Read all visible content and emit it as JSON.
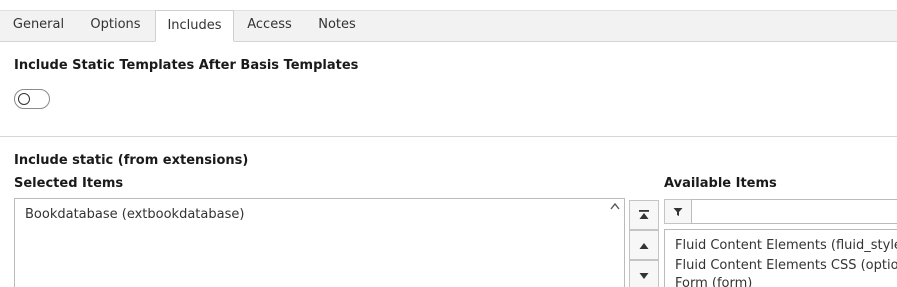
{
  "tabs": [
    {
      "label": "General",
      "active": false
    },
    {
      "label": "Options",
      "active": false
    },
    {
      "label": "Includes",
      "active": true
    },
    {
      "label": "Access",
      "active": false
    },
    {
      "label": "Notes",
      "active": false
    }
  ],
  "static_templates": {
    "title": "Include Static Templates After Basis Templates",
    "toggle_on": false
  },
  "include_static": {
    "title": "Include static (from extensions)",
    "selected_label": "Selected Items",
    "selected_items": [
      "Bookdatabase (extbookdatabase)"
    ],
    "available_label": "Available Items",
    "filter_value": "",
    "available_items": [
      "Fluid Content Elements (fluid_styled_content)",
      "Fluid Content Elements CSS (optional) (fluid_styled_content)",
      "Form (form)"
    ]
  },
  "icons": {
    "move_top": "move-to-top-icon",
    "move_up": "move-up-icon",
    "move_down": "move-down-icon",
    "filter": "filter-icon",
    "scroll_up": "scroll-up-icon"
  },
  "colors": {
    "tabbar_bg": "#f2f2f2",
    "border": "#bbbbbb"
  }
}
